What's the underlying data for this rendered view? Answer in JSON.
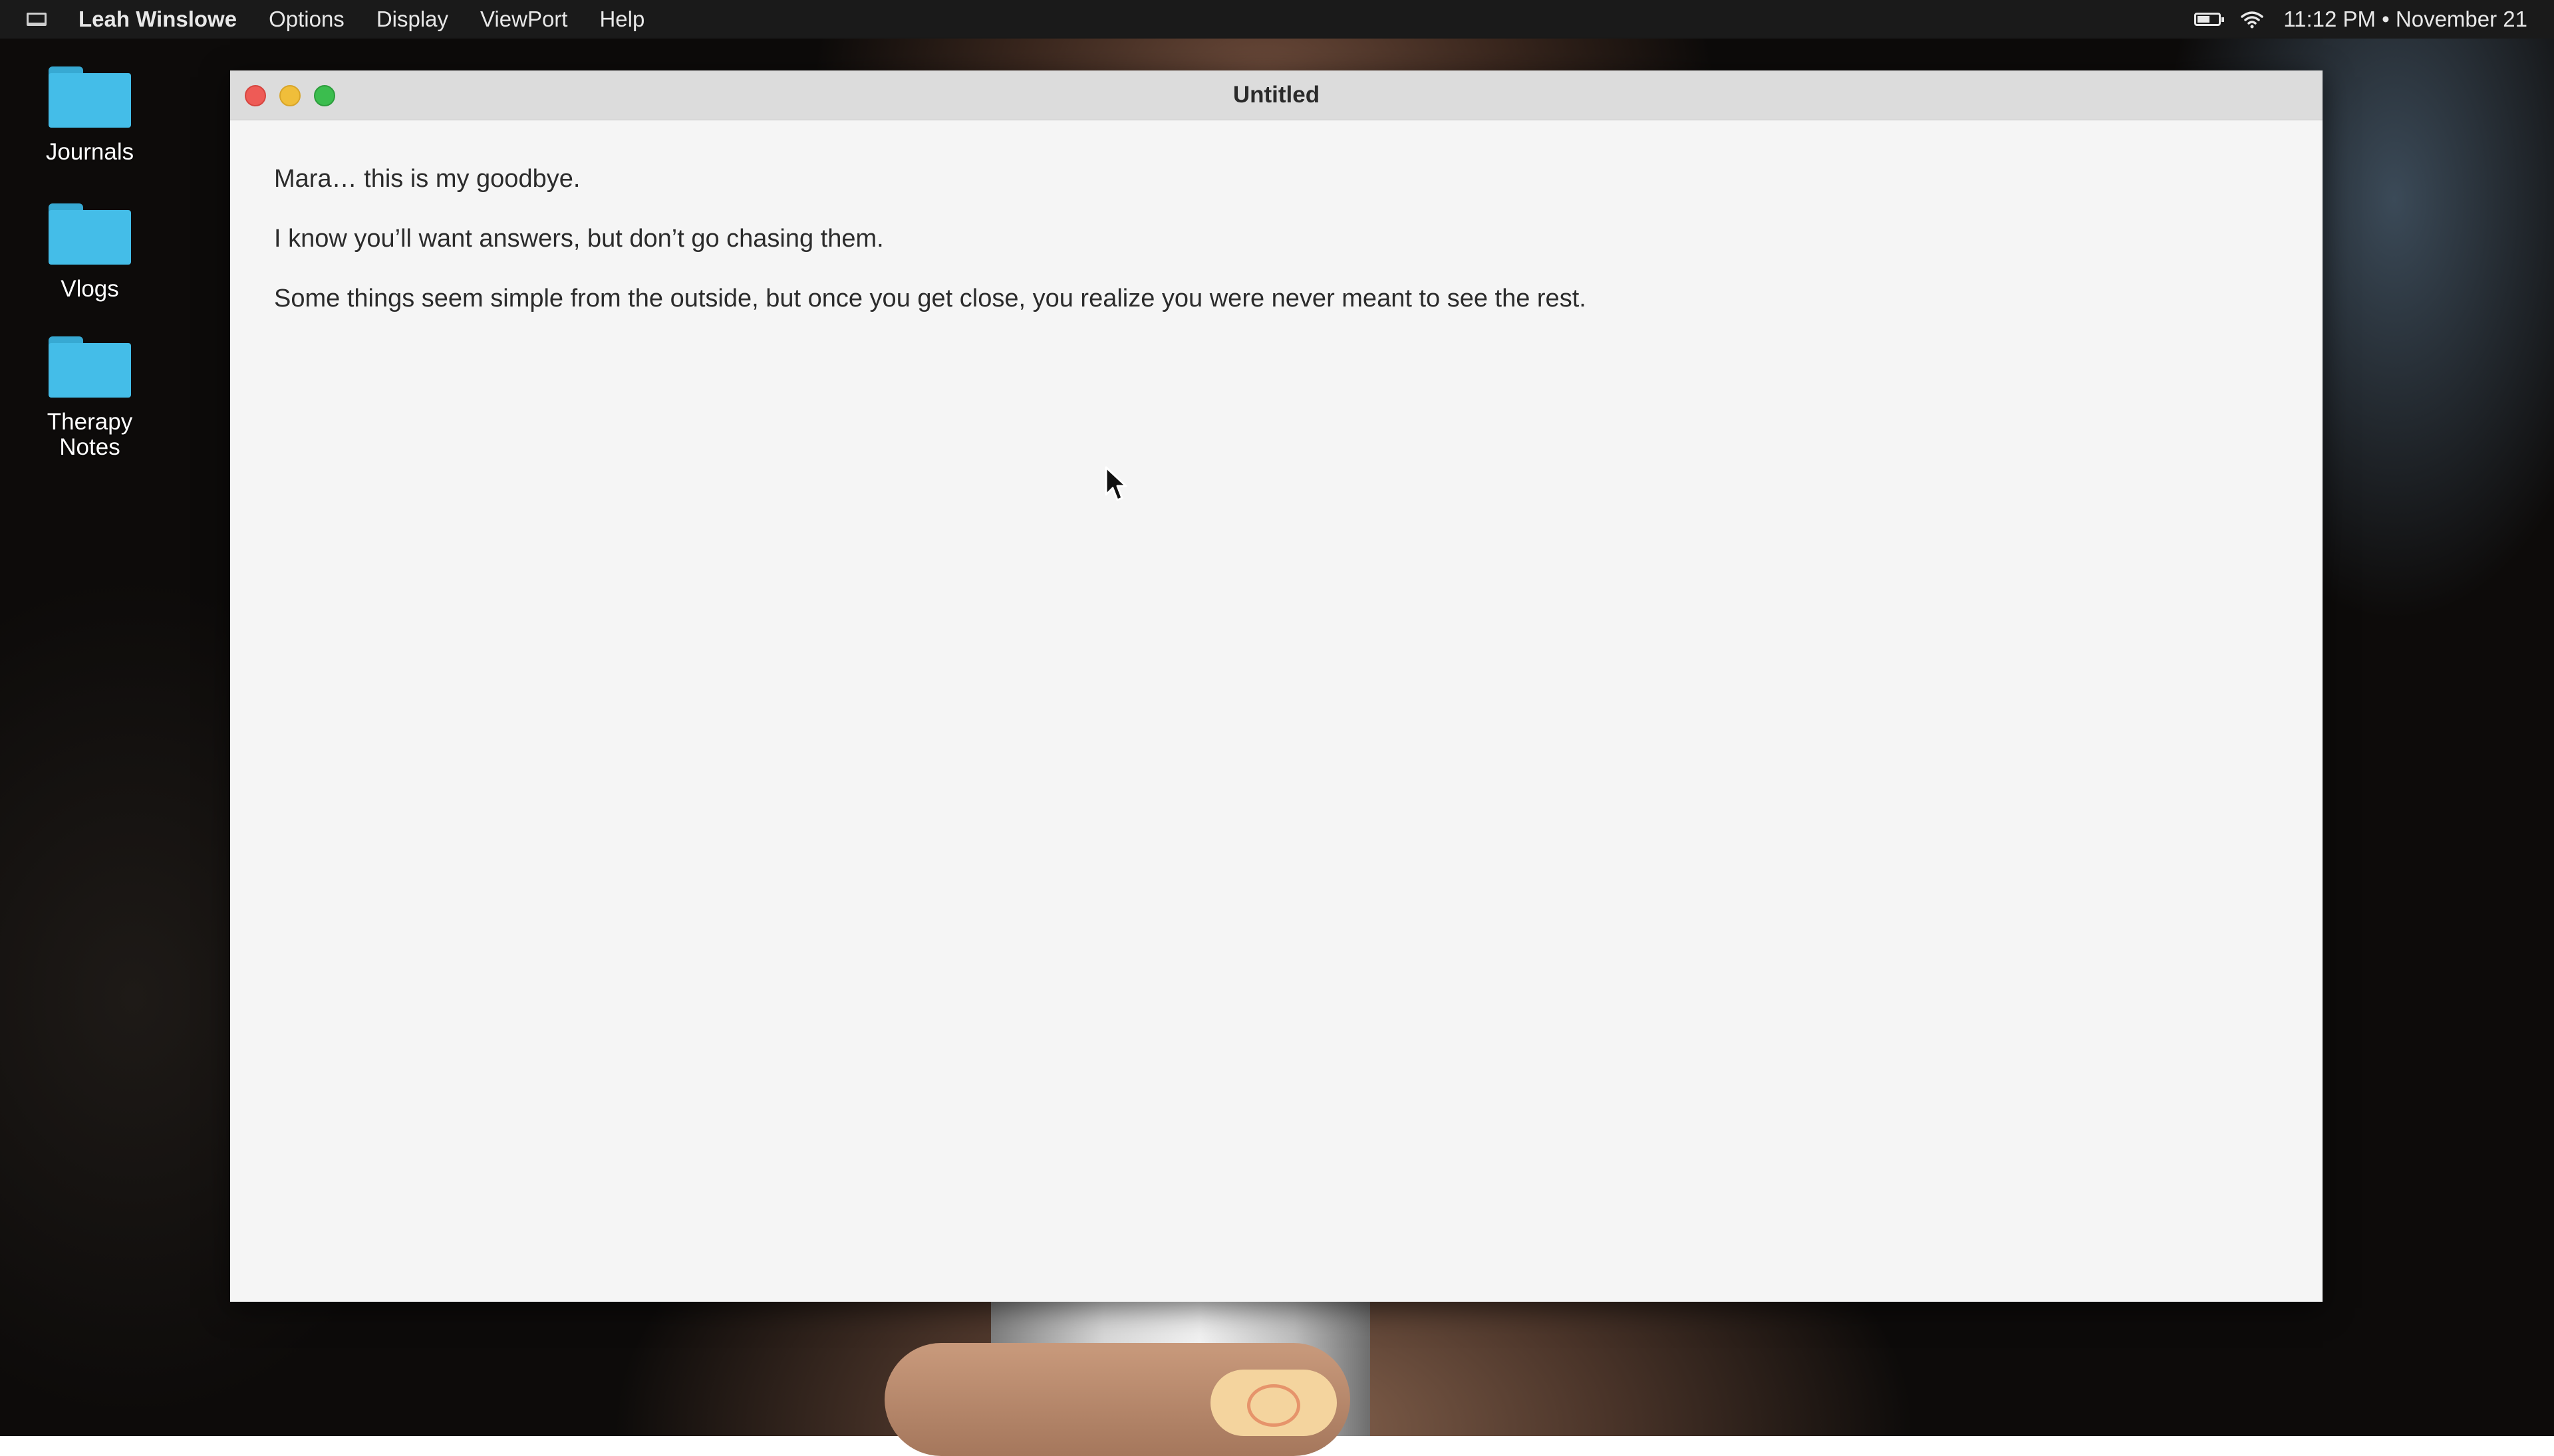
{
  "menubar": {
    "icon": "laptop-icon",
    "app_name": "Leah Winslowe",
    "items": [
      "Options",
      "Display",
      "ViewPort",
      "Help"
    ],
    "status_icons": [
      "battery-icon",
      "wifi-icon"
    ],
    "clock": "11:12 PM • November 21"
  },
  "desktop": {
    "icons": [
      {
        "label": "Journals",
        "icon": "folder-icon",
        "color": "#44bde8"
      },
      {
        "label": "Vlogs",
        "icon": "folder-icon",
        "color": "#44bde8"
      },
      {
        "label": "Therapy Notes",
        "icon": "folder-icon",
        "color": "#44bde8"
      }
    ]
  },
  "window": {
    "title": "Untitled",
    "buttons": {
      "close_color": "#ee5b56",
      "minimize_color": "#f0be3a",
      "maximize_color": "#3bbd4e"
    },
    "lines": [
      "Mara… this is my goodbye.",
      "I know you’ll want answers, but don’t go chasing them.",
      "Some things seem simple from the outside, but once you get close, you realize you were never meant to see the rest."
    ]
  }
}
